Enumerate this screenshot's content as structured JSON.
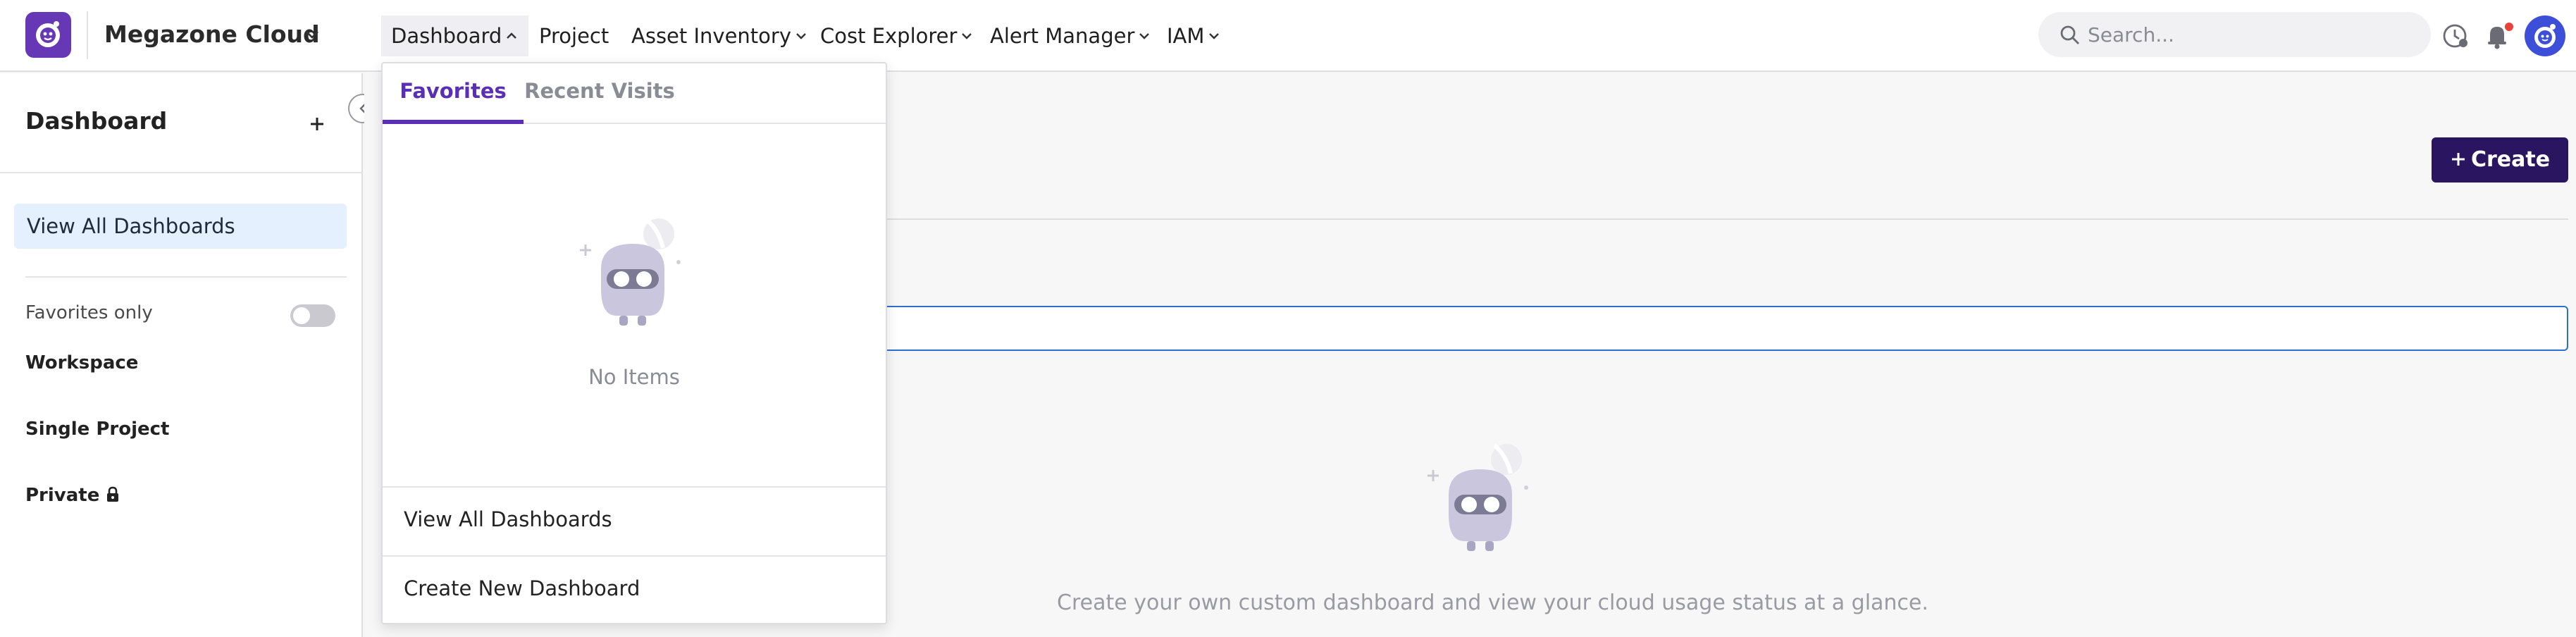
{
  "header": {
    "brand": "Megazone Cloud",
    "nav": [
      {
        "label": "Dashboard",
        "expanded": true
      },
      {
        "label": "Project"
      },
      {
        "label": "Asset Inventory",
        "has_menu": true
      },
      {
        "label": "Cost Explorer",
        "has_menu": true
      },
      {
        "label": "Alert Manager",
        "has_menu": true
      },
      {
        "label": "IAM",
        "has_menu": true
      }
    ],
    "search_placeholder": "Search...",
    "icons": [
      "recent-history-icon",
      "bell-icon",
      "avatar-icon"
    ],
    "colors": {
      "brand": "#6638b6",
      "notification": "#e8423b",
      "avatar": "#3d4fd9"
    }
  },
  "sidebar": {
    "title": "Dashboard",
    "view_all": "View All Dashboards",
    "favorites_only": "Favorites only",
    "favorites_only_on": false,
    "groups": [
      "Workspace",
      "Single Project",
      "Private"
    ]
  },
  "dropdown": {
    "tabs": [
      "Favorites",
      "Recent Visits"
    ],
    "active_tab": "Favorites",
    "empty_text": "No Items",
    "links": [
      "View All Dashboards",
      "Create New Dashboard"
    ],
    "accent": "#5a2fb6"
  },
  "main": {
    "create_label": "Create",
    "empty_message": "Create your own custom dashboard and view your cloud usage status at a glance.",
    "create_button_color": "#2a1560"
  }
}
